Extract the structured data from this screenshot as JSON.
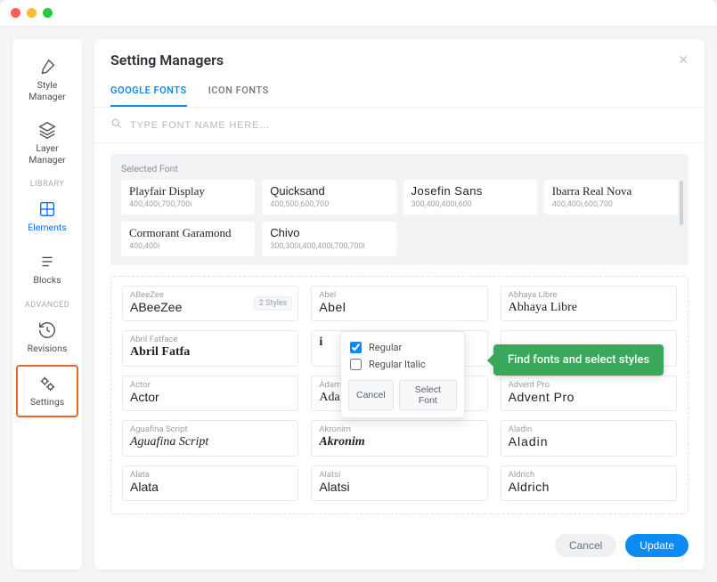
{
  "sidebar": {
    "items": [
      {
        "label": "Style\nManager"
      },
      {
        "label": "Layer\nManager"
      }
    ],
    "section_library": "LIBRARY",
    "lib_items": [
      {
        "label": "Elements"
      },
      {
        "label": "Blocks"
      }
    ],
    "section_advanced": "ADVANCED",
    "adv_items": [
      {
        "label": "Revisions"
      },
      {
        "label": "Settings"
      }
    ]
  },
  "modal": {
    "title": "Setting Managers",
    "tabs": {
      "google": "GOOGLE FONTS",
      "icon": "ICON FONTS"
    },
    "search_placeholder": "TYPE FONT NAME HERE...",
    "selected_label": "Selected Font",
    "selected_fonts": [
      {
        "name": "Playfair Display",
        "weights": "400,400i,700,700i"
      },
      {
        "name": "Quicksand",
        "weights": "400,500,600,700"
      },
      {
        "name": "Josefin Sans",
        "weights": "300,400,400i,600"
      },
      {
        "name": "Ibarra Real Nova",
        "weights": "400,400i,600,700"
      },
      {
        "name": "Cormorant Garamond",
        "weights": "400,400i"
      },
      {
        "name": "Chivo",
        "weights": "300,300i,400,400i,700,700i"
      }
    ],
    "font_list": [
      {
        "mini": "ABeeZee",
        "big": "ABeeZee",
        "badge": "2 Styles"
      },
      {
        "mini": "Abel",
        "big": "Abel"
      },
      {
        "mini": "Abhaya Libre",
        "big": "Abhaya Libre"
      },
      {
        "mini": "Abril Fatface",
        "big": "Abril Fatfa"
      },
      {
        "mini": "",
        "big": "i"
      },
      {
        "mini": "",
        "big": ""
      },
      {
        "mini": "Actor",
        "big": "Actor"
      },
      {
        "mini": "Adamina",
        "big": "Adamina"
      },
      {
        "mini": "Advent Pro",
        "big": "Advent Pro"
      },
      {
        "mini": "Aguafina Script",
        "big": "Aguafina Script"
      },
      {
        "mini": "Akronim",
        "big": "Akronim"
      },
      {
        "mini": "Aladin",
        "big": "Aladin"
      },
      {
        "mini": "Alata",
        "big": "Alata"
      },
      {
        "mini": "Alatsi",
        "big": "Alatsi"
      },
      {
        "mini": "Aldrich",
        "big": "Aldrich"
      }
    ],
    "popover": {
      "opt_regular": "Regular",
      "opt_regular_italic": "Regular Italic",
      "cancel": "Cancel",
      "select": "Select Font"
    },
    "callout": "Find fonts and select styles",
    "footer": {
      "cancel": "Cancel",
      "update": "Update"
    }
  }
}
